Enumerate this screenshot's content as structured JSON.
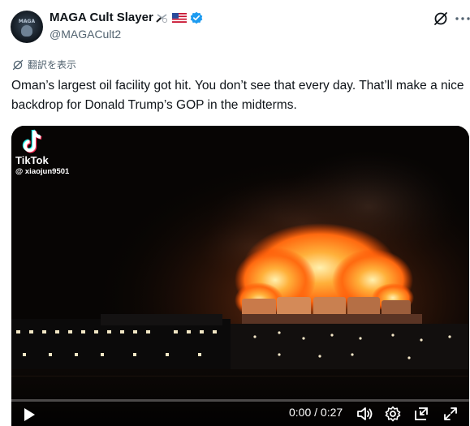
{
  "author": {
    "display_name": "MAGA Cult Slayer",
    "handle": "@MAGACult2",
    "avatar_text": "MAGA"
  },
  "translate_label": "翻訳を表示",
  "tweet_text": "Oman’s largest oil facility got hit. You don’t see that every day. That’ll make a nice backdrop for Donald Trump’s GOP in the midterms.",
  "media": {
    "watermark_brand": "TikTok",
    "watermark_user": "@ xiaojun9501",
    "time_display": "0:00 / 0:27",
    "progress_fraction": 0
  },
  "colors": {
    "verified": "#1d9bf0",
    "text": "#0f1419",
    "secondary": "#536471",
    "fire": "#ff7a1a"
  },
  "icons": [
    "grok-icon",
    "more-icon",
    "translate-icon",
    "play-icon",
    "volume-icon",
    "settings-icon",
    "pip-icon",
    "fullscreen-icon"
  ]
}
